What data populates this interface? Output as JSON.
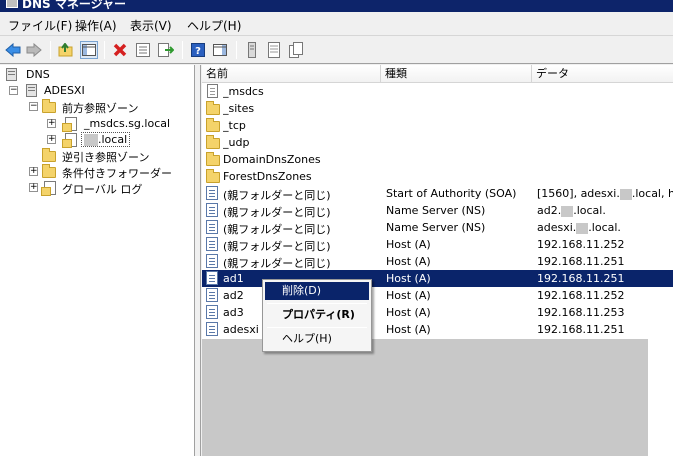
{
  "window": {
    "title": "DNS マネージャー"
  },
  "menu": [
    "ファイル(F)",
    "操作(A)",
    "表示(V)",
    "ヘルプ(H)"
  ],
  "toolbar": {
    "buttons": [
      "back-icon",
      "forward-icon",
      "up-level-icon",
      "show-hide-tree-icon",
      "delete-icon",
      "properties-icon",
      "export-list-icon",
      "help-icon",
      "show-hide-action-pane-icon",
      "server-icon",
      "zone-records-icon",
      "copy-icon"
    ]
  },
  "tree": {
    "root": "DNS",
    "server": "ADESXI",
    "forward_zones": "前方参照ゾーン",
    "msdcs_zone": "_msdcs.sg.local",
    "local_zone": ".local",
    "reverse_zones": "逆引き参照ゾーン",
    "conditional_forwarders": "条件付きフォワーダー",
    "global_logs": "グローバル ログ"
  },
  "list": {
    "columns": [
      "名前",
      "種類",
      "データ"
    ],
    "rows": [
      {
        "icon": "zone-delegation-icon",
        "name": "_msdcs",
        "type": "",
        "data": ""
      },
      {
        "icon": "folder-icon",
        "name": "_sites",
        "type": "",
        "data": ""
      },
      {
        "icon": "folder-icon",
        "name": "_tcp",
        "type": "",
        "data": ""
      },
      {
        "icon": "folder-icon",
        "name": "_udp",
        "type": "",
        "data": ""
      },
      {
        "icon": "folder-icon",
        "name": "DomainDnsZones",
        "type": "",
        "data": ""
      },
      {
        "icon": "folder-icon",
        "name": "ForestDnsZones",
        "type": "",
        "data": ""
      },
      {
        "icon": "record-icon",
        "name": "(親フォルダーと同じ)",
        "type": "Start of Authority (SOA)",
        "data": "[1560], adesxi.",
        "data2": ".local, hos"
      },
      {
        "icon": "record-icon",
        "name": "(親フォルダーと同じ)",
        "type": "Name Server (NS)",
        "data": "ad2.",
        "data2": ".local."
      },
      {
        "icon": "record-icon",
        "name": "(親フォルダーと同じ)",
        "type": "Name Server (NS)",
        "data": "adesxi.",
        "data2": ".local."
      },
      {
        "icon": "record-icon",
        "name": "(親フォルダーと同じ)",
        "type": "Host (A)",
        "data": "192.168.11.252"
      },
      {
        "icon": "record-icon",
        "name": "(親フォルダーと同じ)",
        "type": "Host (A)",
        "data": "192.168.11.251"
      },
      {
        "icon": "record-icon",
        "name": "ad1",
        "type": "Host (A)",
        "data": "192.168.11.251",
        "selected": true
      },
      {
        "icon": "record-icon",
        "name": "ad2",
        "type": "Host (A)",
        "data": "192.168.11.252"
      },
      {
        "icon": "record-icon",
        "name": "ad3",
        "type": "Host (A)",
        "data": "192.168.11.253"
      },
      {
        "icon": "record-icon",
        "name": "adesxi",
        "type": "Host (A)",
        "data": "192.168.11.251"
      }
    ]
  },
  "context_menu": {
    "items": [
      "削除(D)",
      "プロパティ(R)",
      "ヘルプ(H)"
    ]
  }
}
